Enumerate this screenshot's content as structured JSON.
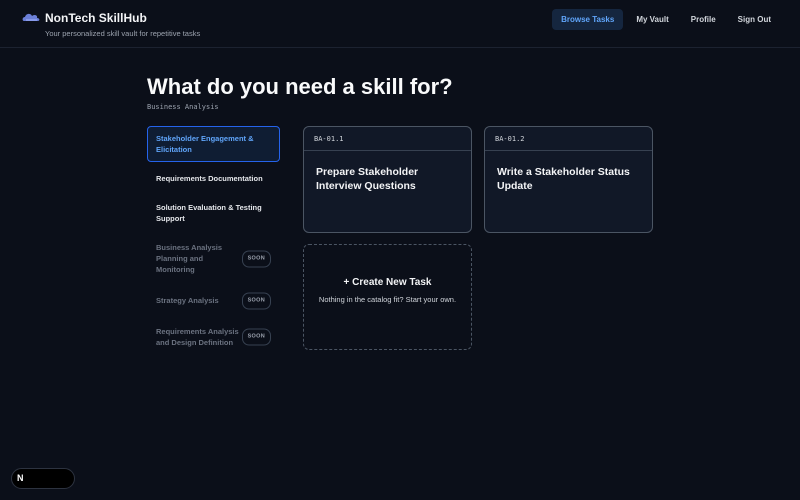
{
  "header": {
    "brand_title": "NonTech SkillHub",
    "brand_subtitle": "Your personalized skill vault for repetitive tasks",
    "nav": [
      {
        "label": "Browse Tasks",
        "active": true
      },
      {
        "label": "My Vault"
      },
      {
        "label": "Profile"
      },
      {
        "label": "Sign Out"
      }
    ]
  },
  "main": {
    "title": "What do you need a skill for?",
    "subtitle": "Business Analysis"
  },
  "sidebar": {
    "items": [
      {
        "label": "Stakeholder Engagement & Elicitation",
        "state": "active"
      },
      {
        "label": "Requirements Documentation"
      },
      {
        "label": "Solution Evaluation & Testing Support"
      },
      {
        "label": "Business Analysis Planning and Monitoring",
        "badge": "SOON"
      },
      {
        "label": "Strategy Analysis",
        "badge": "SOON"
      },
      {
        "label": "Requirements Analysis and Design Definition",
        "badge": "SOON"
      }
    ]
  },
  "cards": [
    {
      "code": "BA-01.1",
      "title": "Prepare Stakeholder Interview Questions"
    },
    {
      "code": "BA-01.2",
      "title": "Write a Stakeholder Status Update"
    }
  ],
  "create_card": {
    "title": "+ Create New Task",
    "subtitle": "Nothing in the catalog fit? Start your own."
  },
  "badge": {
    "letter": "N"
  },
  "colors": {
    "background": "#0b0f19",
    "accent": "#60a5fa",
    "card_bg": "#111827",
    "active_border": "#2563eb"
  },
  "icons": {
    "logo": "cloud-icon",
    "badge": "nextjs-n-icon"
  }
}
